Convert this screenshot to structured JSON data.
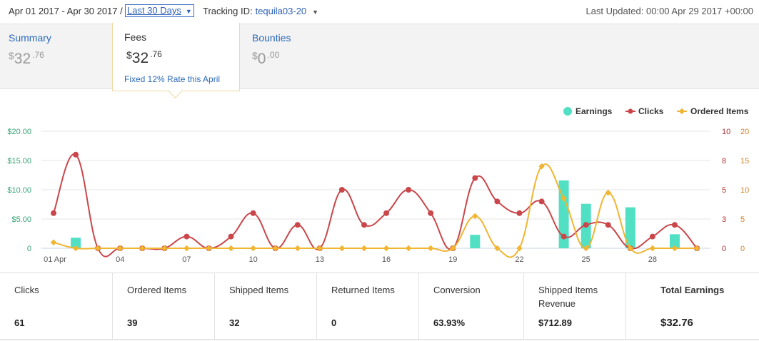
{
  "topbar": {
    "date_range": "Apr 01 2017 - Apr 30 2017 /",
    "period_select": "Last 30 Days",
    "tracking_label": "Tracking ID:",
    "tracking_id": "tequila03-20",
    "last_updated": "Last Updated: 00:00 Apr 29 2017 +00:00"
  },
  "summary": {
    "label": "Summary",
    "currency": "$",
    "whole": "32",
    "cents": ".76"
  },
  "fees": {
    "label": "Fees",
    "currency": "$",
    "whole": "32",
    "cents": ".76",
    "note": "Fixed 12% Rate this April"
  },
  "bounties": {
    "label": "Bounties",
    "currency": "$",
    "whole": "0",
    "cents": ".00"
  },
  "stats": [
    {
      "label": "Clicks",
      "value": "61"
    },
    {
      "label": "Ordered Items",
      "value": "39"
    },
    {
      "label": "Shipped Items",
      "value": "32"
    },
    {
      "label": "Returned Items",
      "value": "0"
    },
    {
      "label": "Conversion",
      "value": "63.93%"
    },
    {
      "label": "Shipped Items Revenue",
      "value": "$712.89"
    },
    {
      "label": "Total Earnings",
      "value": "$32.76"
    }
  ],
  "colors": {
    "earnings": "#52e0c4",
    "clicks": "#c9474b",
    "ordered": "#f0b531",
    "left_axis": "#3aa57a",
    "right_axis_clicks": "#b03030",
    "right_axis_ordered": "#d4832a"
  },
  "chart_data": {
    "type": "bar+line",
    "legend_position": "top-right",
    "days": [
      1,
      2,
      3,
      4,
      5,
      6,
      7,
      8,
      9,
      10,
      11,
      12,
      13,
      14,
      15,
      16,
      17,
      18,
      19,
      20,
      21,
      22,
      23,
      24,
      25,
      26,
      27,
      28,
      29,
      30
    ],
    "x_tick_labels": [
      {
        "day": 1,
        "label": "01 Apr"
      },
      {
        "day": 4,
        "label": "04"
      },
      {
        "day": 7,
        "label": "07"
      },
      {
        "day": 10,
        "label": "10"
      },
      {
        "day": 13,
        "label": "13"
      },
      {
        "day": 16,
        "label": "16"
      },
      {
        "day": 19,
        "label": "19"
      },
      {
        "day": 22,
        "label": "22"
      },
      {
        "day": 25,
        "label": "25"
      },
      {
        "day": 28,
        "label": "28"
      }
    ],
    "y_left": {
      "ticks": [
        "0",
        "$5.00",
        "$10.00",
        "$15.00",
        "$20.00"
      ],
      "max": 20
    },
    "y_right_clicks": {
      "ticks": [
        "0",
        "3",
        "5",
        "8",
        "10"
      ],
      "max": 10
    },
    "y_right_ordered": {
      "ticks": [
        "0",
        "5",
        "10",
        "15",
        "20"
      ],
      "max": 20
    },
    "series": [
      {
        "name": "Earnings",
        "type": "bar",
        "axis": "left",
        "values": [
          0,
          1.8,
          0,
          0,
          0,
          0,
          0,
          0,
          0,
          0,
          0,
          0,
          0,
          0,
          0,
          0,
          0,
          0,
          0,
          2.3,
          0,
          0,
          0,
          11.6,
          7.6,
          0,
          7,
          0,
          2.4,
          0
        ]
      },
      {
        "name": "Clicks",
        "type": "line",
        "axis": "right_clicks",
        "values": [
          3,
          8,
          0,
          0,
          0,
          0,
          1,
          0,
          1,
          3,
          0,
          2,
          0,
          5,
          2,
          3,
          5,
          3,
          0,
          6,
          4,
          3,
          4,
          1,
          2,
          2,
          0,
          1,
          2,
          0
        ]
      },
      {
        "name": "Ordered Items",
        "type": "line",
        "axis": "right_ordered",
        "values": [
          1,
          0,
          0,
          0,
          0,
          0,
          0,
          0,
          0,
          0,
          0,
          0,
          0,
          0,
          0,
          0,
          0,
          0,
          0,
          5.5,
          0,
          0,
          14,
          8.5,
          0,
          9.5,
          0,
          0,
          0,
          0
        ]
      }
    ]
  }
}
